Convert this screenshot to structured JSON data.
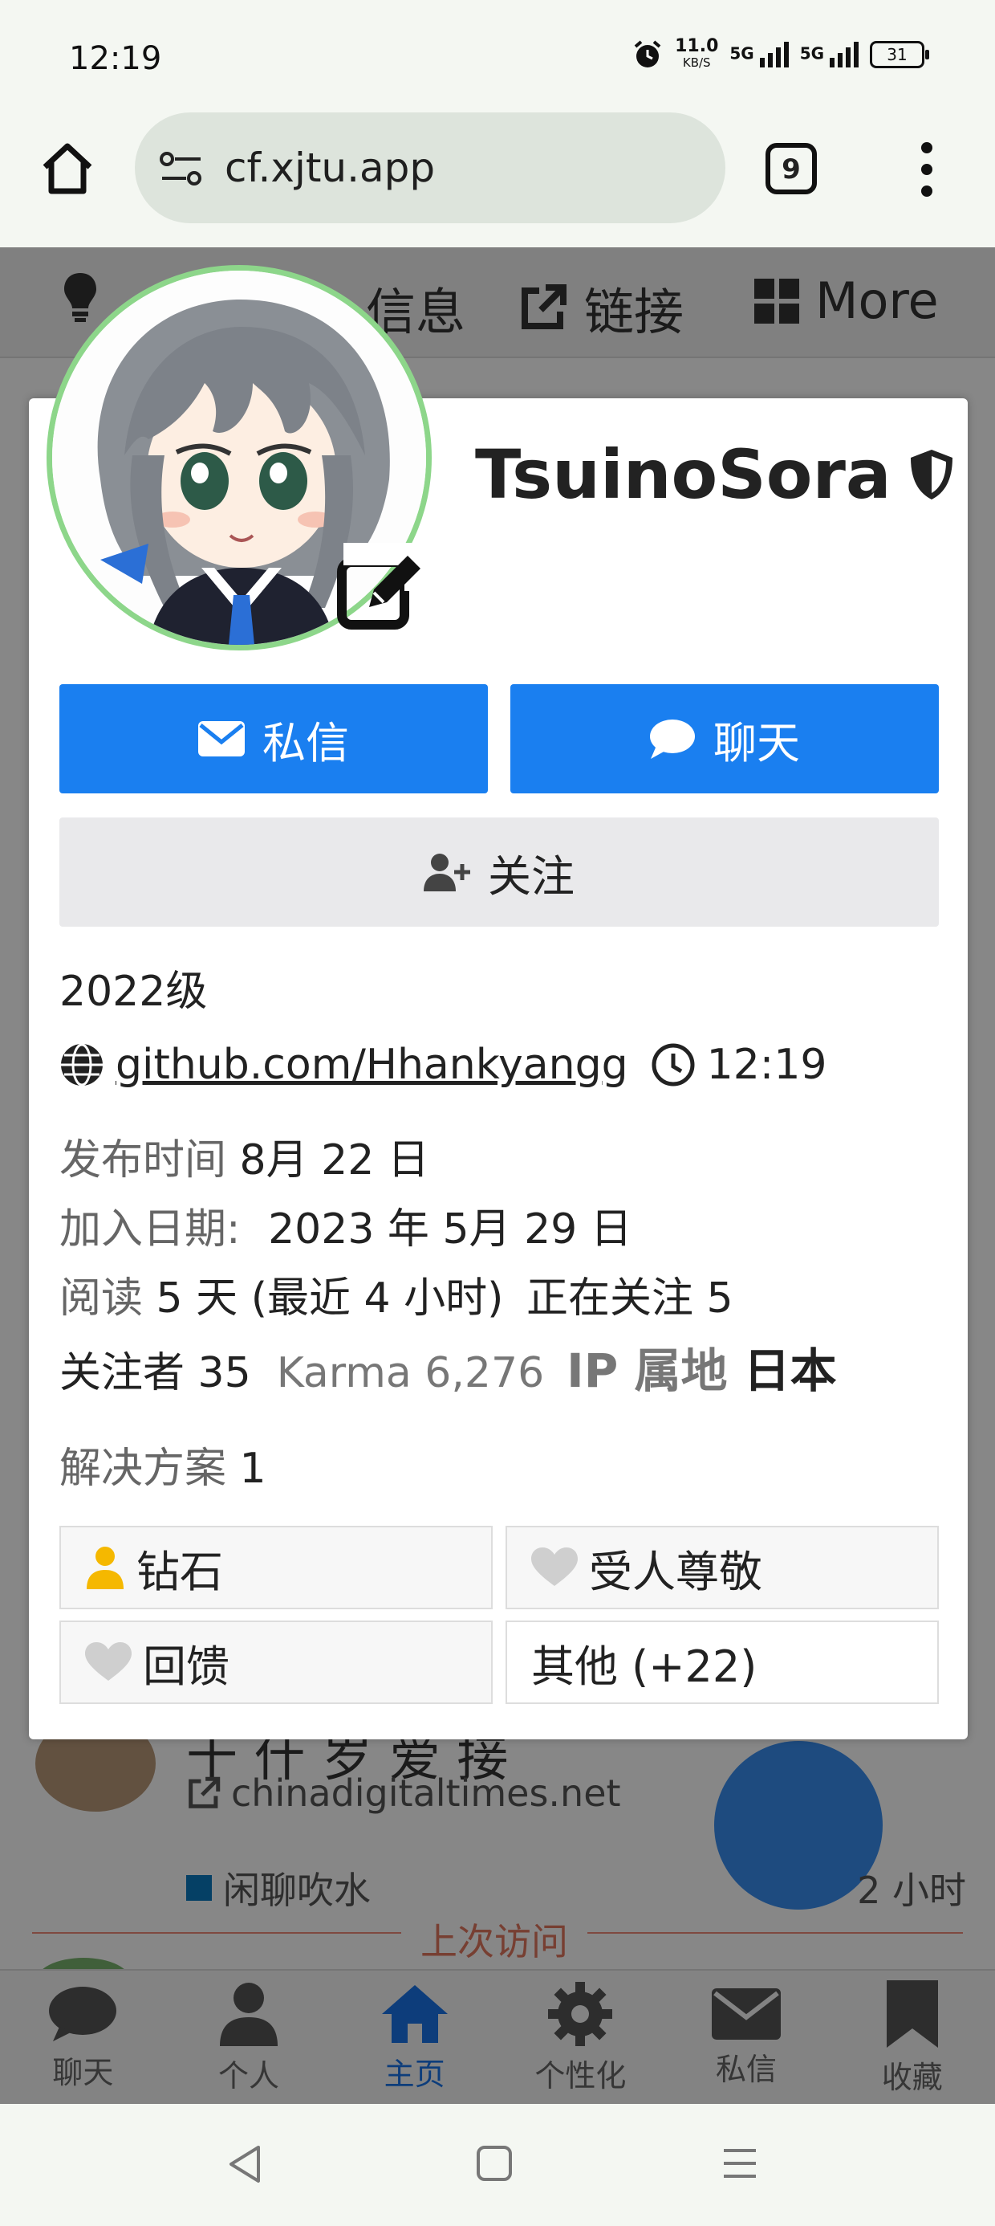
{
  "status_bar": {
    "time": "12:19",
    "net_speed": "11.0",
    "net_speed_unit": "KB/S",
    "signal_1": "5G",
    "signal_2": "5G",
    "battery": "31"
  },
  "browser": {
    "url": "cf.xjtu.app",
    "tab_count": "9"
  },
  "top_nav": {
    "items": [
      {
        "label": "信息",
        "icon": "info-icon"
      },
      {
        "label": "链接",
        "icon": "external-link-icon"
      },
      {
        "label": "More",
        "icon": "grid-icon"
      }
    ]
  },
  "background_topic": {
    "headline": "十 什 岁 爱 接",
    "link": "chinadigitaltimes.net",
    "category": "闲聊吹水",
    "age": "2 小时",
    "separator": "上次访问"
  },
  "bottom_tabs": [
    {
      "label": "聊天",
      "icon": "chat-icon"
    },
    {
      "label": "个人",
      "icon": "user-icon"
    },
    {
      "label": "主页",
      "icon": "home-icon",
      "active": true
    },
    {
      "label": "个性化",
      "icon": "gear-icon"
    },
    {
      "label": "私信",
      "icon": "envelope-icon"
    },
    {
      "label": "收藏",
      "icon": "bookmark-icon"
    }
  ],
  "profile": {
    "username": "TsuinoSora",
    "actions": {
      "message": "私信",
      "chat": "聊天",
      "follow": "关注"
    },
    "title": "2022级",
    "website": "github.com/Hhankyangg",
    "local_time": "12:19",
    "posted_label": "发布时间",
    "posted_value": "8月 22 日",
    "joined_label": "加入日期:",
    "joined_value": "2023 年 5月 29 日",
    "read_label": "阅读",
    "read_value": "5 天 (最近 4 小时)",
    "following_label": "正在关注",
    "following_value": "5",
    "followers_label": "关注者",
    "followers_value": "35",
    "karma_label": "Karma",
    "karma_value": "6,276",
    "ip_label": "IP 属地",
    "ip_value": "日本",
    "solutions_label": "解决方案",
    "solutions_value": "1",
    "badges": [
      "钻石",
      "受人尊敬",
      "回馈",
      "其他 (+22)"
    ]
  },
  "colors": {
    "accent": "#1a7ff0",
    "avatar_ring": "#8dd68a",
    "badge_gold": "#f5b800"
  }
}
